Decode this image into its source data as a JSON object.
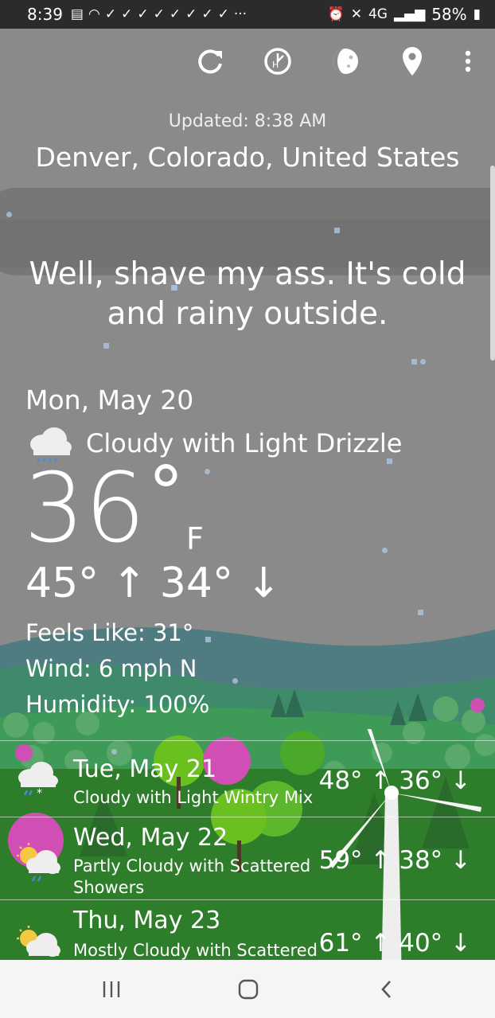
{
  "status_bar": {
    "time": "8:39",
    "network": "4G",
    "battery": "58%"
  },
  "toolbar": {
    "icons": [
      "refresh-icon",
      "history-icon",
      "moon-phase-icon",
      "location-pin-icon",
      "more-vert-icon"
    ]
  },
  "header": {
    "updated": "Updated: 8:38 AM",
    "location": "Denver, Colorado, United States"
  },
  "quip": "Well, shave my ass. It's cold and rainy outside.",
  "current": {
    "date": "Mon, May 20",
    "condition": "Cloudy with Light Drizzle",
    "temp": "36",
    "degree": "°",
    "unit": "F",
    "hilo": "45° ↑ 34° ↓",
    "feels_like": "Feels Like: 31°",
    "wind": "Wind: 6 mph N",
    "humidity": "Humidity: 100%"
  },
  "forecast": [
    {
      "day": "Tue, May 21",
      "desc": "Cloudy with Light Wintry Mix",
      "temps": "48° ↑ 36° ↓",
      "icon": "cloud-wintry-mix-icon"
    },
    {
      "day": "Wed, May 22",
      "desc": "Partly Cloudy with Scattered Showers",
      "temps": "59° ↑ 38° ↓",
      "icon": "partly-cloudy-showers-icon"
    },
    {
      "day": "Thu, May 23",
      "desc": "Mostly Cloudy with Scattered",
      "temps": "61° ↑ 40° ↓",
      "icon": "mostly-cloudy-showers-icon"
    }
  ],
  "colors": {
    "sky": "#8a8a8a",
    "grass": "#2e7d2a",
    "accent_pink": "#d14fb5"
  }
}
